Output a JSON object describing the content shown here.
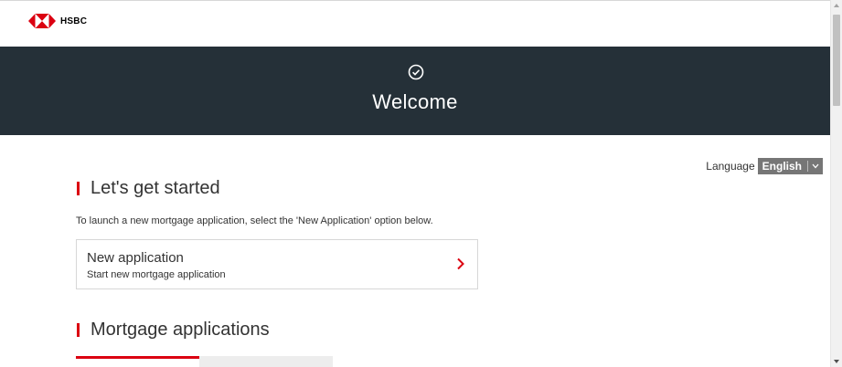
{
  "header": {
    "brand_name": "HSBC",
    "logo_icon": "hsbc-hexagon-logo",
    "brand_color": "#db0011"
  },
  "banner": {
    "icon": "check-circle-icon",
    "title": "Welcome",
    "background": "#253038"
  },
  "language": {
    "label": "Language",
    "selected": "English"
  },
  "get_started": {
    "heading": "Let's get started",
    "intro": "To launch a new mortgage application, select the 'New Application' option below.",
    "card": {
      "title": "New application",
      "subtitle": "Start new mortgage application",
      "icon": "chevron-right-icon"
    }
  },
  "applications": {
    "heading": "Mortgage applications"
  }
}
